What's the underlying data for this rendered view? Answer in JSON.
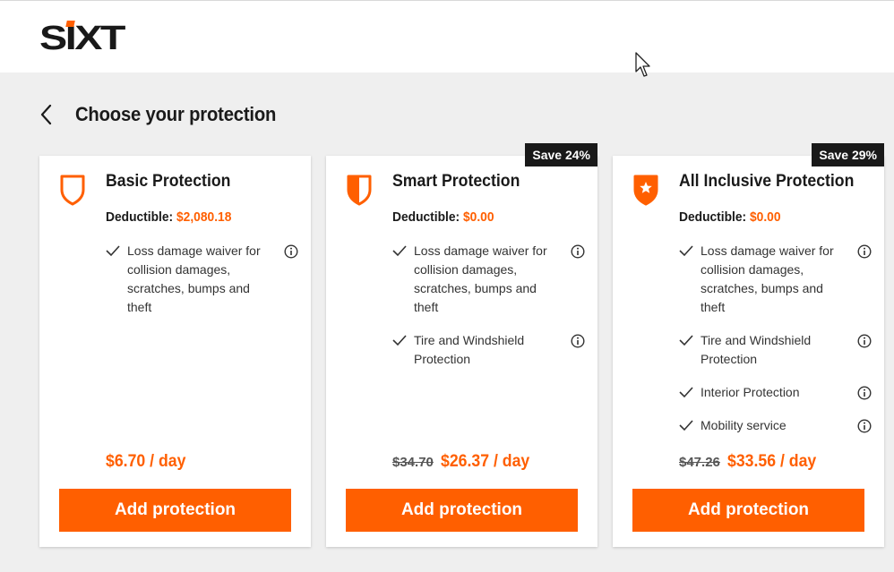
{
  "header": {
    "logo_text": "SIXT",
    "colors": {
      "brand": "#ff5f00",
      "dark": "#191919",
      "background": "#efefef"
    }
  },
  "page": {
    "title": "Choose your protection",
    "back_icon": "chevron-left-icon"
  },
  "cards": [
    {
      "title": "Basic Protection",
      "icon": "shield-outline-icon",
      "save_badge": "",
      "deductible_label": "Deductible:",
      "deductible_value": "$2,080.18",
      "features": [
        "Loss damage waiver for collision damages, scratches, bumps and theft"
      ],
      "old_price": "",
      "price": "$6.70 / day",
      "button_label": "Add protection"
    },
    {
      "title": "Smart Protection",
      "icon": "shield-half-icon",
      "save_badge": "Save 24%",
      "deductible_label": "Deductible:",
      "deductible_value": "$0.00",
      "features": [
        "Loss damage waiver for collision damages, scratches, bumps and theft",
        "Tire and Windshield Protection"
      ],
      "old_price": "$34.70",
      "price": "$26.37 / day",
      "button_label": "Add protection"
    },
    {
      "title": "All Inclusive Protection",
      "icon": "shield-star-icon",
      "save_badge": "Save 29%",
      "deductible_label": "Deductible:",
      "deductible_value": "$0.00",
      "features": [
        "Loss damage waiver for collision damages, scratches, bumps and theft",
        "Tire and Windshield Protection",
        "Interior Protection",
        "Mobility service"
      ],
      "old_price": "$47.26",
      "price": "$33.56 / day",
      "button_label": "Add protection"
    }
  ]
}
